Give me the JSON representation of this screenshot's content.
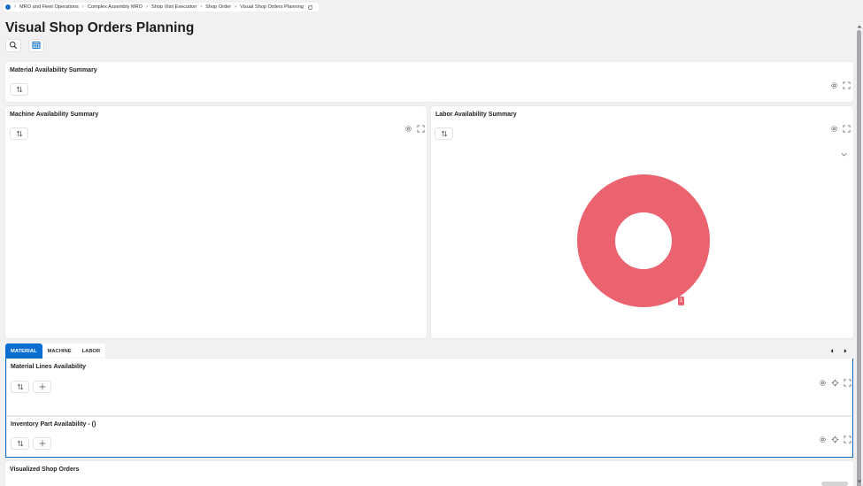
{
  "breadcrumb": {
    "items": [
      "MRO and Fleet Operations",
      "Complex Assembly MRO",
      "Shop Visit Execution",
      "Shop Order",
      "Visual Shop Orders Planning"
    ]
  },
  "page": {
    "title": "Visual Shop Orders Planning"
  },
  "toolbar": {
    "search_icon": "search-icon",
    "table_icon": "table-icon"
  },
  "cards": {
    "material_summary": {
      "title": "Material Availability Summary"
    },
    "machine_summary": {
      "title": "Machine Availability Summary"
    },
    "labor_summary": {
      "title": "Labor Availability Summary",
      "legend_marker": "1"
    },
    "material_lines": {
      "title": "Material Lines Availability"
    },
    "inventory_part": {
      "title": "Inventory Part Availability - ()"
    },
    "visualized_orders": {
      "title": "Visualized Shop Orders"
    }
  },
  "tabs": [
    "MATERIAL",
    "MACHINE",
    "LABOR"
  ],
  "active_tab": "MATERIAL",
  "chart_data": {
    "type": "pie",
    "title": "",
    "categories": [
      ""
    ],
    "values": [
      1
    ],
    "colors": [
      "#ec6370"
    ],
    "donut": true
  },
  "colors": {
    "accent": "#0a6ed1",
    "donut": "#ec6370"
  }
}
